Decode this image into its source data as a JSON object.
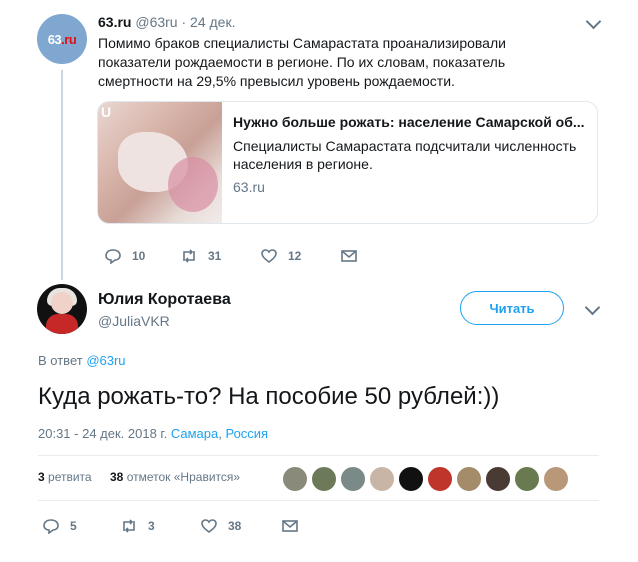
{
  "tweet1": {
    "avatar_text_1": "63",
    "avatar_text_2": ".ru",
    "name": "63.ru",
    "handle": "@63ru",
    "dot": "·",
    "date": "24 дек.",
    "text": "Помимо браков специалисты Самарастата проанализировали показатели рождаемости в регионе. По их словам, показатель смертности на 29,5% превысил уровень рождаемости.",
    "card": {
      "image_mark": "U",
      "title": "Нужно больше рожать: население Самарской об...",
      "description": "Специалисты Самарастата подсчитали численность населения в регионе.",
      "domain": "63.ru"
    },
    "actions": {
      "replies": "10",
      "retweets": "31",
      "likes": "12"
    }
  },
  "tweet2": {
    "name": "Юлия Коротаева",
    "handle": "@JuliaVKR",
    "follow_label": "Читать",
    "reply_prefix": "В ответ ",
    "reply_to": "@63ru",
    "text": "Куда рожать-то? На пособие 50 рублей:))",
    "meta_time": "20:31 - 24 дек. 2018 г.",
    "meta_city": "Самара",
    "meta_sep": ",",
    "meta_country": "Россия",
    "retweets_count": "3",
    "retweets_label": "ретвита",
    "likes_count": "38",
    "likes_label": "отметок «Нравится»",
    "actions": {
      "replies": "5",
      "retweets": "3",
      "likes": "38"
    }
  },
  "likers": [
    "#8a8a7a",
    "#6d7a5a",
    "#7a8a88",
    "#c8b5a5",
    "#111111",
    "#c0352b",
    "#a48c6a",
    "#4a3a34",
    "#6a7a50",
    "#b89878"
  ]
}
